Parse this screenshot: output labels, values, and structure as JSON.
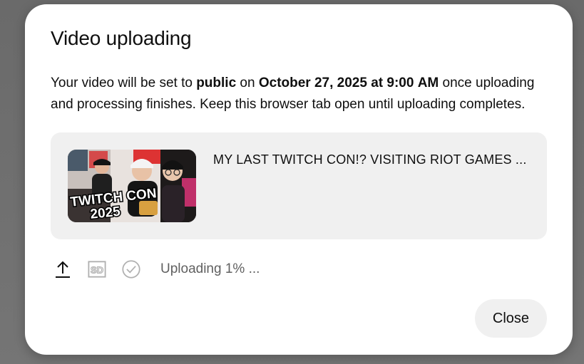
{
  "dialog": {
    "title": "Video uploading",
    "message": {
      "part1": "Your video will be set to ",
      "visibility": "public",
      "part2": " on ",
      "datetime": "October 27, 2025 at 9:00 AM",
      "part3": " once uploading and processing finishes. Keep this browser tab open until uploading completes."
    },
    "video": {
      "title": "MY LAST TWITCH CON!? VISITING RIOT GAMES ...",
      "thumbnail_text_line1": "TWITCH CON",
      "thumbnail_text_line2": "2025"
    },
    "status": {
      "icons": [
        "upload-icon",
        "sd-quality-icon",
        "check-circle-icon"
      ],
      "sd_label": "SD",
      "text": "Uploading 1% ...",
      "progress_percent": 1
    },
    "close_label": "Close"
  },
  "colors": {
    "backdrop": "#6f6f6f",
    "dialog_bg": "#ffffff",
    "card_bg": "#f0f0f0",
    "text_primary": "#0f0f0f",
    "text_secondary": "#606060",
    "icon_inactive": "#b0b0b0"
  }
}
